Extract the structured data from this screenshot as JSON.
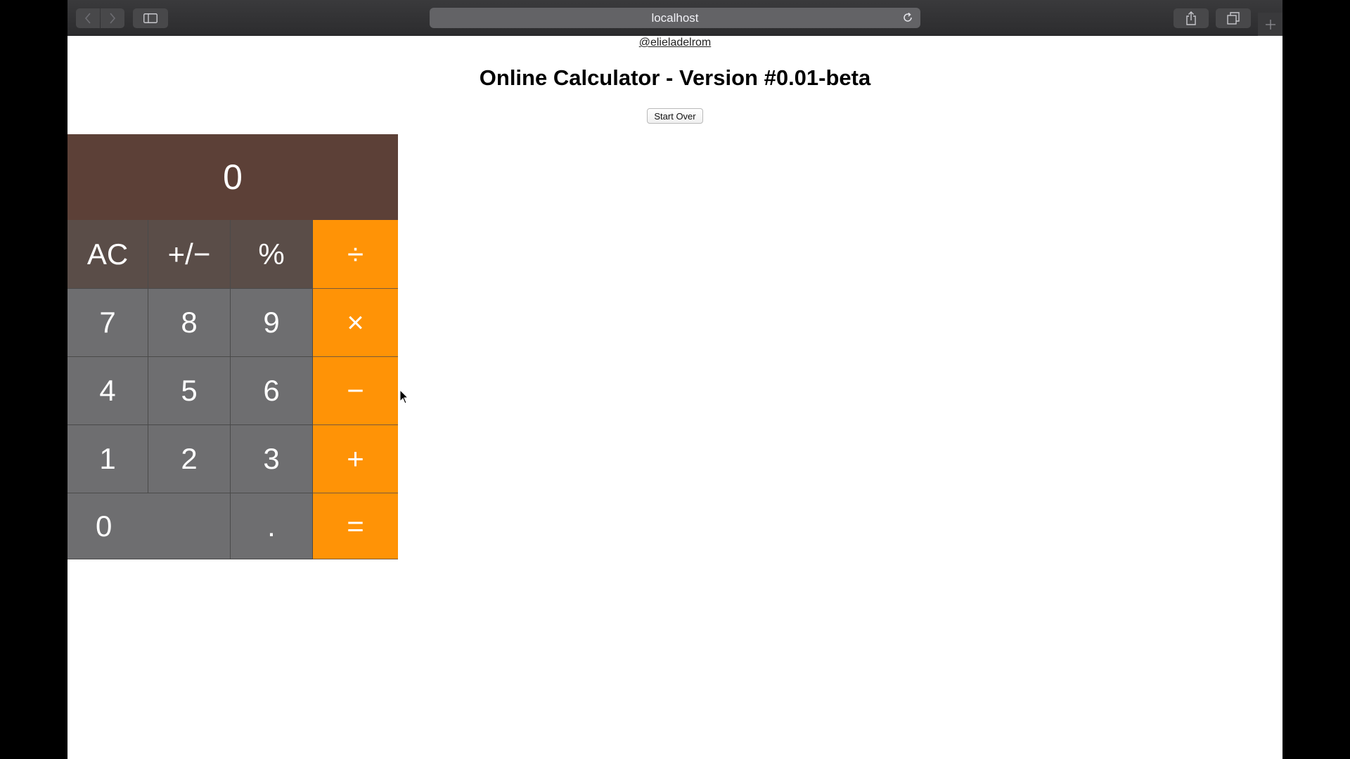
{
  "browser": {
    "url": "localhost"
  },
  "page": {
    "author": "@elieladelrom",
    "title": "Online Calculator - Version #0.01-beta",
    "start_over_label": "Start Over"
  },
  "calculator": {
    "display": "0",
    "rows": [
      [
        {
          "label": "AC",
          "kind": "fn"
        },
        {
          "label": "+/−",
          "kind": "fn"
        },
        {
          "label": "%",
          "kind": "fn"
        },
        {
          "label": "÷",
          "kind": "op"
        }
      ],
      [
        {
          "label": "7",
          "kind": "num"
        },
        {
          "label": "8",
          "kind": "num"
        },
        {
          "label": "9",
          "kind": "num"
        },
        {
          "label": "×",
          "kind": "op"
        }
      ],
      [
        {
          "label": "4",
          "kind": "num"
        },
        {
          "label": "5",
          "kind": "num"
        },
        {
          "label": "6",
          "kind": "num"
        },
        {
          "label": "−",
          "kind": "op"
        }
      ],
      [
        {
          "label": "1",
          "kind": "num"
        },
        {
          "label": "2",
          "kind": "num"
        },
        {
          "label": "3",
          "kind": "num"
        },
        {
          "label": "+",
          "kind": "op"
        }
      ],
      [
        {
          "label": "0",
          "kind": "num"
        },
        {
          "label": ".",
          "kind": "num"
        },
        {
          "label": "=",
          "kind": "op"
        }
      ]
    ]
  },
  "colors": {
    "display_bg": "#5c4037",
    "function_key": "#5a4d48",
    "number_key": "#6e6e70",
    "operator_key": "#ff9306"
  }
}
